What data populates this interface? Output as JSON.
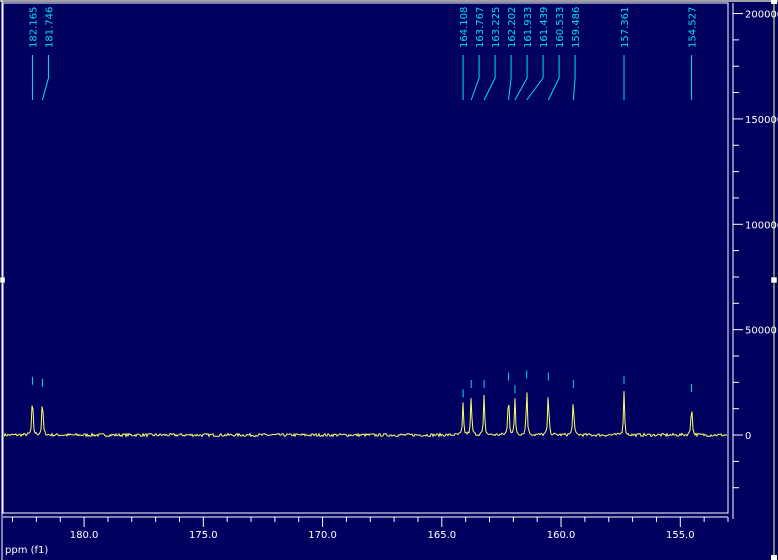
{
  "chart_data": {
    "type": "line",
    "title": "",
    "xlabel": "ppm (f1)",
    "ylabel": "",
    "xlim": [
      183.4,
      153.0
    ],
    "ylim": [
      -37000,
      205000
    ],
    "x_ticks": [
      "180.0",
      "175.0",
      "170.0",
      "165.0",
      "160.0",
      "155.0"
    ],
    "x_tick_values": [
      180,
      175,
      170,
      165,
      160,
      155
    ],
    "y_ticks": [
      "0",
      "50000",
      "100000",
      "150000",
      "200000"
    ],
    "y_tick_values": [
      0,
      50000,
      100000,
      150000,
      200000
    ],
    "grid": false,
    "peaks": [
      {
        "ppm": 182.165,
        "label": "182.165",
        "intensity": 21000
      },
      {
        "ppm": 181.746,
        "label": "181.746",
        "intensity": 20000
      },
      {
        "ppm": 164.108,
        "label": "164.108",
        "intensity": 15000
      },
      {
        "ppm": 163.767,
        "label": "163.767",
        "intensity": 19500
      },
      {
        "ppm": 163.225,
        "label": "163.225",
        "intensity": 19500
      },
      {
        "ppm": 162.202,
        "label": "162.202",
        "intensity": 23000
      },
      {
        "ppm": 161.933,
        "label": "161.933",
        "intensity": 17000
      },
      {
        "ppm": 161.439,
        "label": "161.439",
        "intensity": 24000
      },
      {
        "ppm": 160.533,
        "label": "160.533",
        "intensity": 23000
      },
      {
        "ppm": 159.486,
        "label": "159.486",
        "intensity": 19500
      },
      {
        "ppm": 157.361,
        "label": "157.361",
        "intensity": 21500
      },
      {
        "ppm": 154.527,
        "label": "154.527",
        "intensity": 17500
      }
    ],
    "colors": {
      "background": "#000060",
      "spectrum": "#ffff66",
      "peak_labels": "#00e0e8",
      "axes": "#ffffff"
    }
  }
}
